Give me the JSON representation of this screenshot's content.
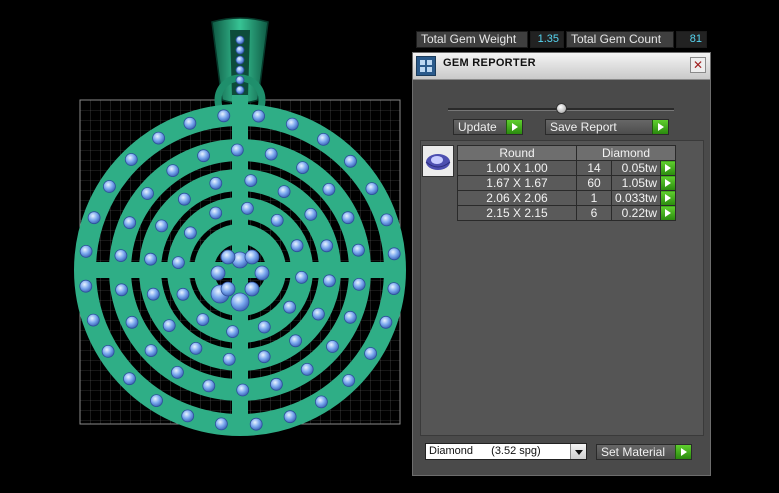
{
  "viewport": {
    "label": "3D jewelry design viewport",
    "colors": {
      "metal": "#2fae86",
      "gem": "#6f9de6",
      "grid": "#5a5a5a"
    }
  },
  "panel": {
    "title": "GEM REPORTER",
    "icon": "app-icon",
    "total_weight_label": "Total Gem Weight",
    "total_weight_value": "1.35",
    "total_count_label": "Total Gem Count",
    "total_count_value": "81",
    "update_label": "Update",
    "save_report_label": "Save Report",
    "table": {
      "headers": [
        "Round",
        "Diamond"
      ],
      "rows": [
        {
          "size": "1.00 X 1.00",
          "qty": "14",
          "weight": "0.05tw"
        },
        {
          "size": "1.67 X 1.67",
          "qty": "60",
          "weight": "1.05tw"
        },
        {
          "size": "2.06 X 2.06",
          "qty": "1",
          "weight": "0.033tw"
        },
        {
          "size": "2.15 X 2.15",
          "qty": "6",
          "weight": "0.22tw"
        }
      ]
    },
    "material_select": {
      "name": "Diamond",
      "density": "(3.52 spg)"
    },
    "set_material_label": "Set Material",
    "accent_green": "#3fb51c",
    "value_color": "#57d6f2"
  }
}
